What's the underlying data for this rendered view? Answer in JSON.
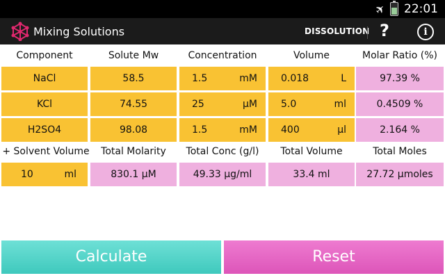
{
  "status": {
    "time": "22:01"
  },
  "app": {
    "title": "Mixing Solutions",
    "mode_label": "DISSOLUTION",
    "help_label": "?",
    "info_label": "i"
  },
  "headers": [
    "Component",
    "Solute Mw",
    "Concentration",
    "Volume",
    "Molar Ratio (%)"
  ],
  "rows": [
    {
      "component": "NaCl",
      "mw": "58.5",
      "conc_value": "1.5",
      "conc_unit": "mM",
      "vol_value": "0.018",
      "vol_unit": "L",
      "ratio": "97.39 %"
    },
    {
      "component": "KCl",
      "mw": "74.55",
      "conc_value": "25",
      "conc_unit": "µM",
      "vol_value": "5.0",
      "vol_unit": "ml",
      "ratio": "0.4509 %"
    },
    {
      "component": "H2SO4",
      "mw": "98.08",
      "conc_value": "1.5",
      "conc_unit": "mM",
      "vol_value": "400",
      "vol_unit": "µl",
      "ratio": "2.164 %"
    }
  ],
  "summary_headers": [
    "+ Solvent Volume",
    "Total Molarity",
    "Total Conc (g/l)",
    "Total Volume",
    "Total Moles"
  ],
  "summary": {
    "solvent_value": "10",
    "solvent_unit": "ml",
    "total_molarity": "830.1 µM",
    "total_conc": "49.33 µg/ml",
    "total_volume": "33.4 ml",
    "total_moles": "27.72 µmoles"
  },
  "buttons": {
    "calculate": "Calculate",
    "reset": "Reset"
  },
  "colors": {
    "input": "#f9c233",
    "output": "#efb0df",
    "calculate": "#4fd3c6",
    "reset": "#e466c4"
  }
}
